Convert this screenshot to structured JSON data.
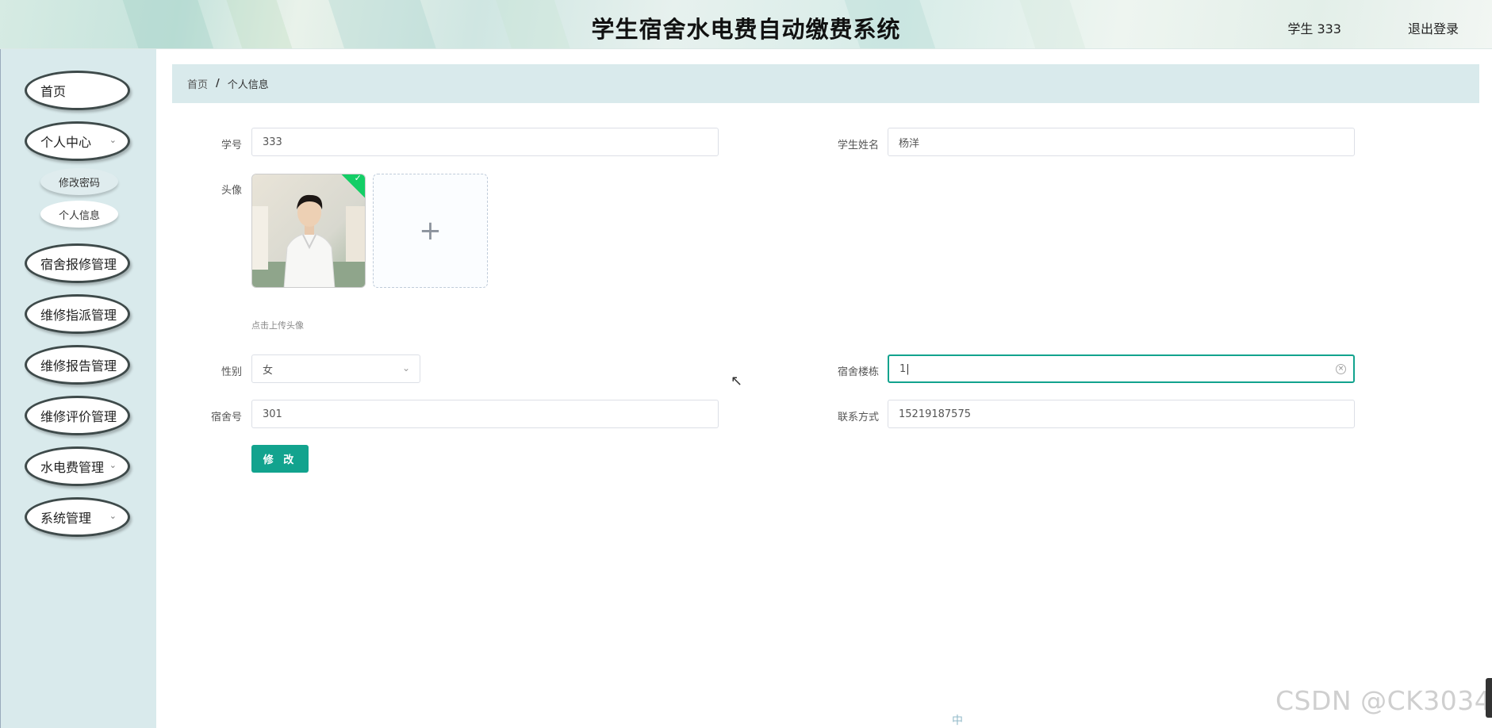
{
  "header": {
    "title": "学生宿舍水电费自动缴费系统",
    "user": "学生 333",
    "logout": "退出登录"
  },
  "sidebar": {
    "items": [
      {
        "label": "首页"
      },
      {
        "label": "个人中心",
        "has_submenu": true
      },
      {
        "label": "宿舍报修管理"
      },
      {
        "label": "维修指派管理"
      },
      {
        "label": "维修报告管理"
      },
      {
        "label": "维修评价管理"
      },
      {
        "label": "水电费管理",
        "has_submenu": true
      },
      {
        "label": "系统管理",
        "has_submenu": true
      }
    ],
    "subitems": [
      {
        "label": "修改密码"
      },
      {
        "label": "个人信息",
        "active": true
      }
    ]
  },
  "breadcrumb": {
    "home": "首页",
    "separator": "/",
    "current": "个人信息"
  },
  "form": {
    "student_id": {
      "label": "学号",
      "value": "333"
    },
    "student_name": {
      "label": "学生姓名",
      "value": "杨洋"
    },
    "avatar": {
      "label": "头像",
      "upload_hint": "点击上传头像",
      "upload_icon": "+"
    },
    "gender": {
      "label": "性别",
      "value": "女"
    },
    "building": {
      "label": "宿舍楼栋",
      "value": "1"
    },
    "room": {
      "label": "宿舍号",
      "value": "301"
    },
    "contact": {
      "label": "联系方式",
      "value": "15219187575"
    },
    "submit": "修 改"
  },
  "watermark": "CSDN @CK3034",
  "ime_toolbar": "中"
}
